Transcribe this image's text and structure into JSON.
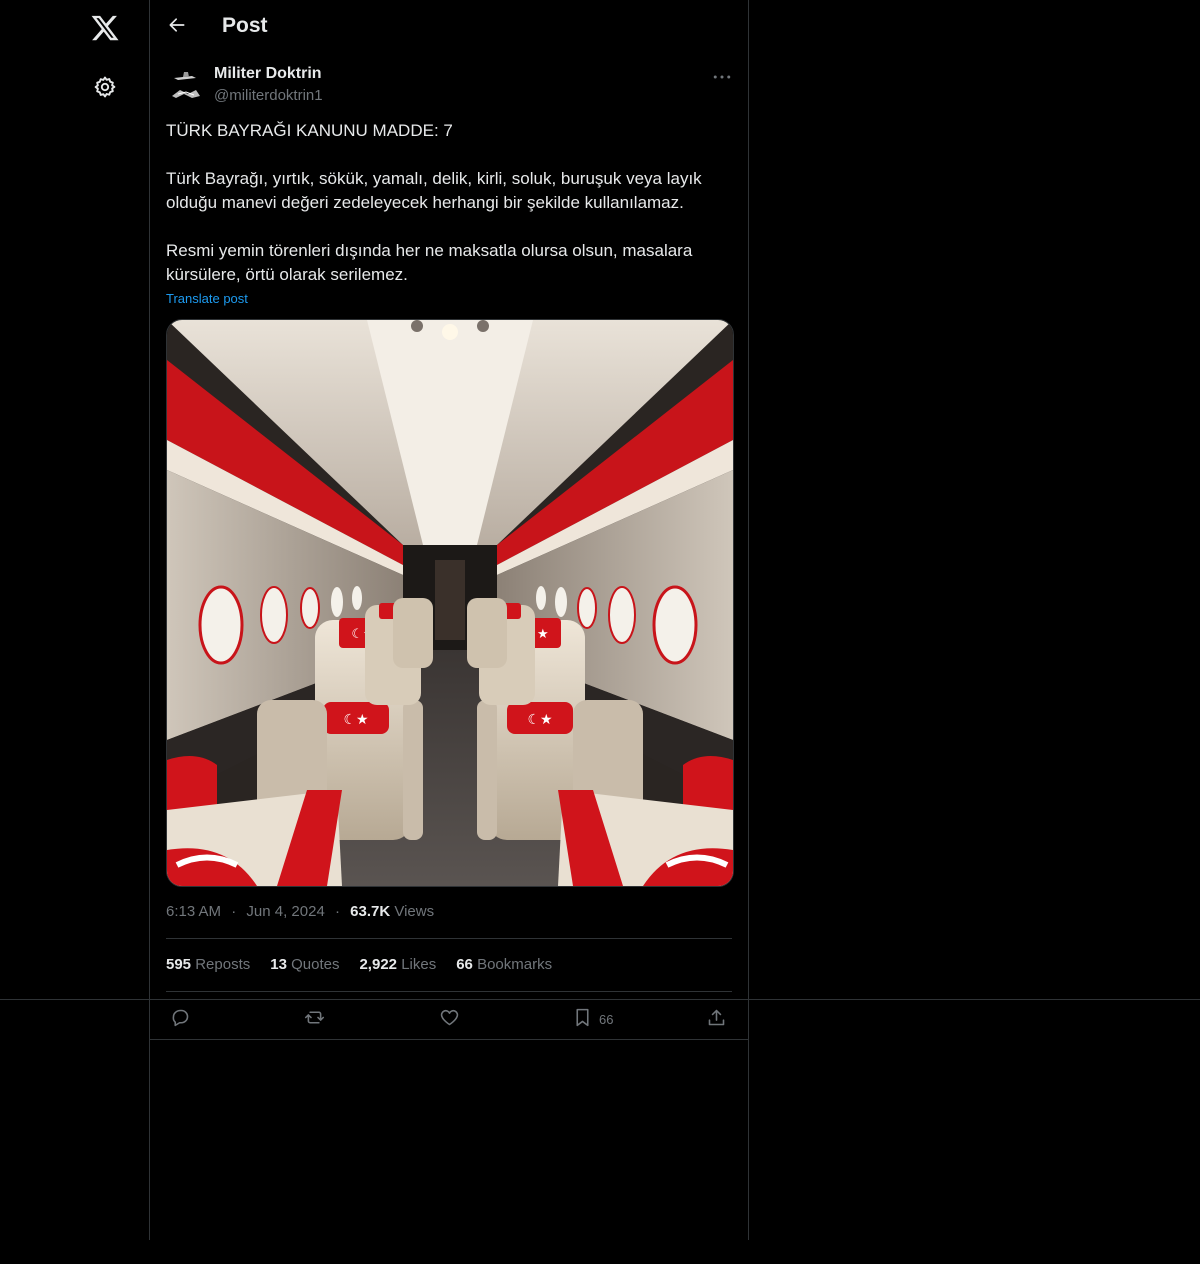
{
  "header": {
    "title": "Post"
  },
  "post": {
    "author_name": "Militer Doktrin",
    "author_handle": "@militerdoktrin1",
    "paragraphs": [
      "TÜRK BAYRAĞI KANUNU MADDE: 7",
      "Türk Bayrağı, yırtık, sökük, yamalı, delik, kirli, soluk, buruşuk veya layık olduğu manevi değeri zedeleyecek herhangi bir şekilde kullanılamaz.",
      "Resmi yemin törenleri dışında her ne maksatla olursa olsun, masalara kürsülere, örtü olarak serilemez."
    ],
    "translate_label": "Translate post",
    "time": "6:13 AM",
    "date": "Jun 4, 2024",
    "views_count": "63.7K",
    "views_label": "Views",
    "separator": "·"
  },
  "stats": {
    "reposts_count": "595",
    "reposts_label": "Reposts",
    "quotes_count": "13",
    "quotes_label": "Quotes",
    "likes_count": "2,922",
    "likes_label": "Likes",
    "bookmarks_count": "66",
    "bookmarks_label": "Bookmarks"
  },
  "actions": {
    "bookmark_count": "66"
  },
  "icons": {
    "logo": "x-logo-icon",
    "settings": "gear-icon",
    "back": "arrow-left-icon",
    "more": "more-horizontal-icon",
    "reply": "reply-icon",
    "repost": "repost-icon",
    "like": "heart-icon",
    "bookmark": "bookmark-icon",
    "share": "share-icon"
  },
  "colors": {
    "background": "#000000",
    "text": "#e7e9ea",
    "secondary": "#71767b",
    "link": "#1d9bf0",
    "border": "#2f3336",
    "flag_red": "#d81e1e"
  }
}
